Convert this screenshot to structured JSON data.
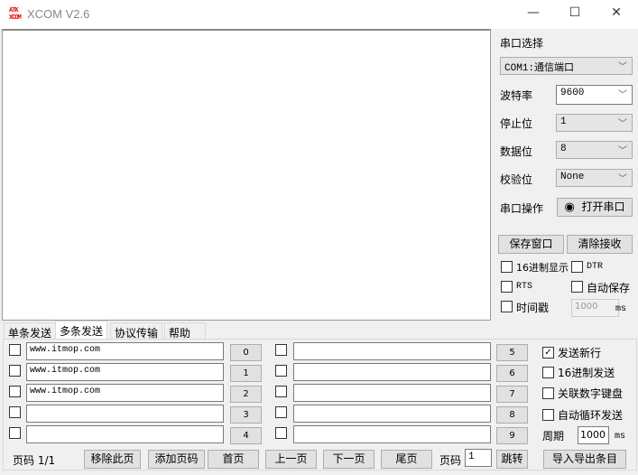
{
  "window": {
    "logo": "ATK XCOM",
    "title": "XCOM V2.6",
    "minimize": "—",
    "maximize": "☐",
    "close": "✕"
  },
  "serial": {
    "port_label": "串口选择",
    "port_value": "COM1:通信端口",
    "baud_label": "波特率",
    "baud_value": "9600",
    "stop_label": "停止位",
    "stop_value": "1",
    "data_label": "数据位",
    "data_value": "8",
    "parity_label": "校验位",
    "parity_value": "None",
    "op_label": "串口操作",
    "open_button": "打开串口",
    "save_window": "保存窗口",
    "clear_recv": "清除接收",
    "hex_display": "16进制显示",
    "dtr": "DTR",
    "rts": "RTS",
    "auto_save": "自动保存",
    "timestamp": "时间戳",
    "timestamp_value": "1000",
    "ms": "ms"
  },
  "tabs": [
    {
      "label": "单条发送"
    },
    {
      "label": "多条发送"
    },
    {
      "label": "协议传输"
    },
    {
      "label": "帮助"
    }
  ],
  "multi": {
    "rows": [
      {
        "value": "www.itmop.com",
        "button": "0"
      },
      {
        "value": "www.itmop.com",
        "button": "1"
      },
      {
        "value": "www.itmop.com",
        "button": "2"
      },
      {
        "value": "",
        "button": "3"
      },
      {
        "value": "",
        "button": "4"
      },
      {
        "value": "",
        "button": "5"
      },
      {
        "value": "",
        "button": "6"
      },
      {
        "value": "",
        "button": "7"
      },
      {
        "value": "",
        "button": "8"
      },
      {
        "value": "",
        "button": "9"
      }
    ],
    "send_newline": "发送新行",
    "hex_send": "16进制发送",
    "numpad": "关联数字键盘",
    "auto_loop": "自动循环发送",
    "period_label": "周期",
    "period_value": "1000",
    "ms": "ms",
    "page_info": "页码 1/1",
    "remove_page": "移除此页",
    "add_page": "添加页码",
    "first": "首页",
    "prev": "上一页",
    "next": "下一页",
    "last": "尾页",
    "page_label": "页码",
    "page_value": "1",
    "jump": "跳转",
    "import_export": "导入导出条目"
  }
}
